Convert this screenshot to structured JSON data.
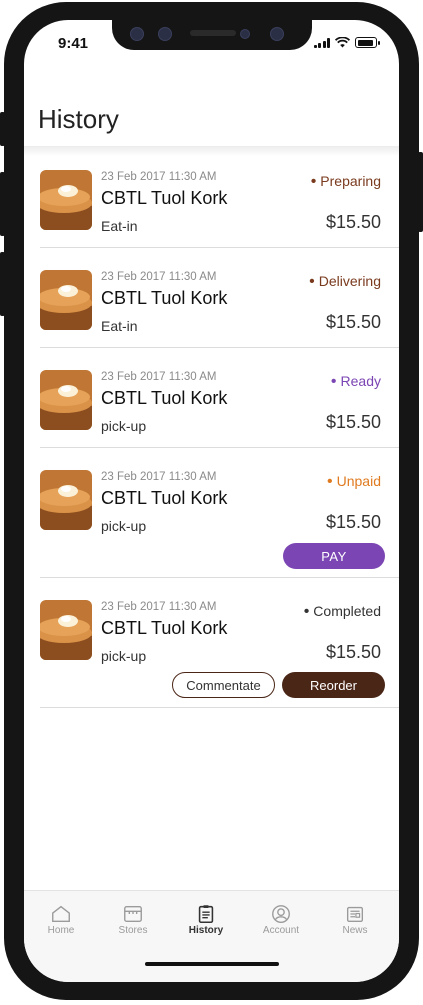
{
  "status_bar": {
    "time": "9:41"
  },
  "header": {
    "title": "History"
  },
  "orders": [
    {
      "date": "23 Feb 2017 11:30 AM",
      "store": "CBTL Tuol Kork",
      "type": "Eat-in",
      "status": "Preparing",
      "status_color": "#7a3a1e",
      "price": "$15.50"
    },
    {
      "date": "23 Feb 2017 11:30 AM",
      "store": "CBTL Tuol Kork",
      "type": "Eat-in",
      "status": "Delivering",
      "status_color": "#7a3a1e",
      "price": "$15.50"
    },
    {
      "date": "23 Feb 2017 11:30 AM",
      "store": "CBTL Tuol Kork",
      "type": "pick-up",
      "status": "Ready",
      "status_color": "#7b45b3",
      "price": "$15.50"
    },
    {
      "date": "23 Feb 2017 11:30 AM",
      "store": "CBTL Tuol Kork",
      "type": "pick-up",
      "status": "Unpaid",
      "status_color": "#e07a1f",
      "price": "$15.50",
      "action": "PAY"
    },
    {
      "date": "23 Feb 2017 11:30 AM",
      "store": "CBTL Tuol Kork",
      "type": "pick-up",
      "status": "Completed",
      "status_color": "#333333",
      "price": "$15.50",
      "actions": [
        "Commentate",
        "Reorder"
      ]
    }
  ],
  "tabs": [
    {
      "label": "Home",
      "icon": "home-icon",
      "active": false
    },
    {
      "label": "Stores",
      "icon": "store-icon",
      "active": false
    },
    {
      "label": "History",
      "icon": "clipboard-icon",
      "active": true
    },
    {
      "label": "Account",
      "icon": "account-icon",
      "active": false
    },
    {
      "label": "News",
      "icon": "news-icon",
      "active": false
    }
  ],
  "colors": {
    "accent_brown": "#4a2617",
    "accent_purple": "#7b45b3"
  }
}
